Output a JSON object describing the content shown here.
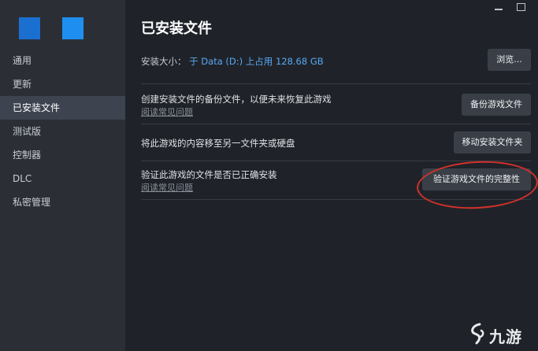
{
  "sidebar": {
    "items": [
      {
        "label": "通用"
      },
      {
        "label": "更新"
      },
      {
        "label": "已安装文件",
        "active": true
      },
      {
        "label": "测试版"
      },
      {
        "label": "控制器"
      },
      {
        "label": "DLC"
      },
      {
        "label": "私密管理"
      }
    ]
  },
  "main": {
    "title": "已安装文件",
    "install_size": {
      "label": "安装大小：",
      "value": "于 Data (D:) 上占用 128.68 GB",
      "button": "浏览..."
    },
    "backup": {
      "text": "创建安装文件的备份文件，以便未来恢复此游戏",
      "link": "阅读常见问题",
      "button": "备份游戏文件"
    },
    "move": {
      "text": "将此游戏的内容移至另一文件夹或硬盘",
      "button": "移动安装文件夹"
    },
    "verify": {
      "text": "验证此游戏的文件是否已正确安装",
      "link": "阅读常见问题",
      "button": "验证游戏文件的完整性"
    }
  },
  "watermark": {
    "text": "九游"
  },
  "colors": {
    "accent": "#58a9f5",
    "highlight_circle": "#d2312c",
    "sidebar_bg": "#2b2f35",
    "main_bg": "#1f2329"
  }
}
